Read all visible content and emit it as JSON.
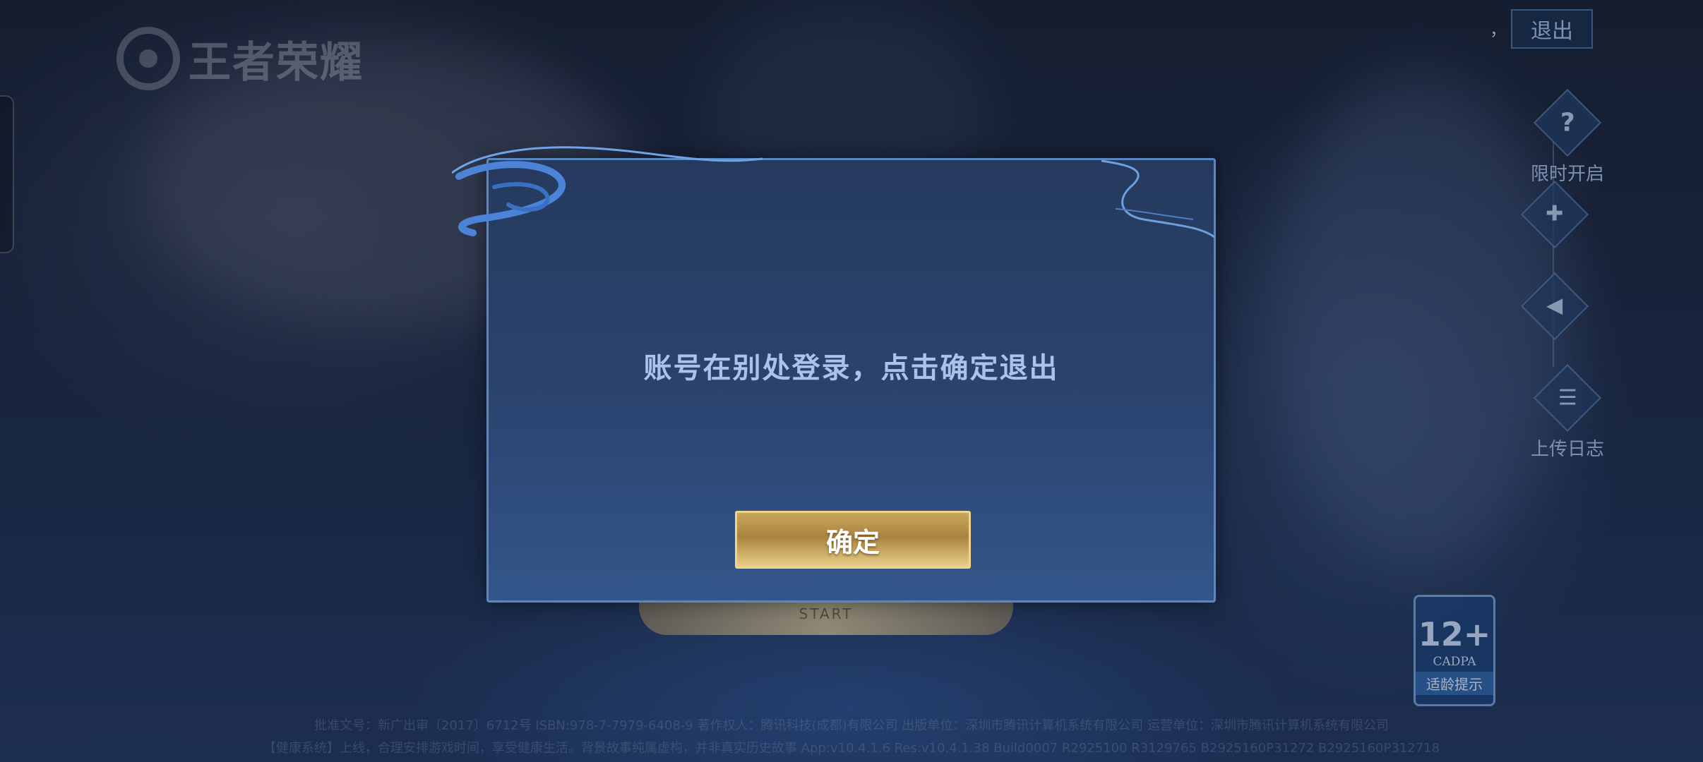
{
  "app": {
    "logo_text": "王者荣耀"
  },
  "header": {
    "separator": "，",
    "exit_label": "退出"
  },
  "side_menu": {
    "items": [
      {
        "icon": "question-icon",
        "glyph": "?",
        "label": "限时开启"
      },
      {
        "icon": "gamepad-icon",
        "glyph": "🎮",
        "label": ""
      },
      {
        "icon": "speaker-icon",
        "glyph": "🔊",
        "label": ""
      },
      {
        "icon": "clipboard-icon",
        "glyph": "📋",
        "label": "上传日志"
      }
    ]
  },
  "start": {
    "label": "START"
  },
  "age_rating": {
    "age": "12+",
    "org": "CADPA",
    "tip": "适龄提示"
  },
  "footer": {
    "line1": "批准文号：新广出审〔2017〕6712号  ISBN:978-7-7979-6408-9  著作权人：腾讯科技(成都)有限公司  出版单位：深圳市腾讯计算机系统有限公司  运营单位：深圳市腾讯计算机系统有限公司",
    "line2": "【健康系统】上线，合理安排游戏时间，享受健康生活。背景故事纯属虚构，并非真实历史故事 App:v10.4.1.6 Res:v10.4.1.38 Build0007 R2925100 R3129765 B2925160P31272 B2925160P312718"
  },
  "dialog": {
    "message": "账号在别处登录，点击确定退出",
    "confirm_label": "确定"
  },
  "colors": {
    "dialog_border": "#5a86c4",
    "message_text": "#a9c4e8",
    "gold_button": "#c9a55b"
  }
}
